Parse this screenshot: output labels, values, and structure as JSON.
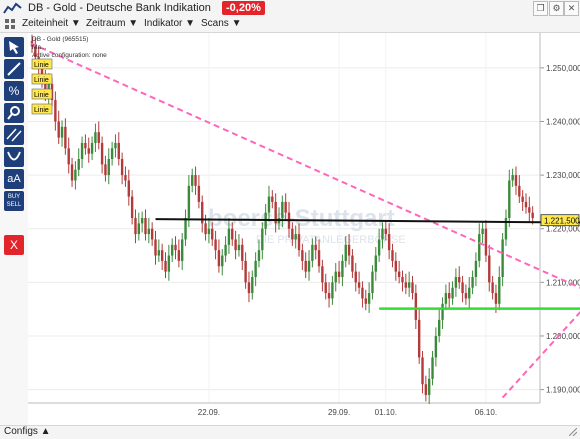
{
  "window": {
    "title": "DB - Gold - Deutsche Bank Indikation",
    "change": "-0,20%"
  },
  "menu": {
    "items": [
      "Zeiteinheit ▼",
      "Zeitraum ▼",
      "Indikator ▼",
      "Scans ▼"
    ]
  },
  "tools": [
    {
      "name": "select-cursor-icon",
      "label": ""
    },
    {
      "name": "line-tool-icon",
      "label": ""
    },
    {
      "name": "percent-tool-icon",
      "label": "%"
    },
    {
      "name": "zoom-icon",
      "label": ""
    },
    {
      "name": "channel-tool-icon",
      "label": ""
    },
    {
      "name": "curve-tool-icon",
      "label": ""
    },
    {
      "name": "text-tool-icon",
      "label": "aA"
    },
    {
      "name": "buy-sell-icon",
      "label": "BUY SELL"
    },
    {
      "name": "delete-icon",
      "label": "X"
    }
  ],
  "status": {
    "configs": "Configs ▲"
  },
  "colors": {
    "up": "#3b8a3b",
    "down": "#b33a3a",
    "trend": "#ff66bb",
    "support": "#33dd33",
    "resistance": "#111111",
    "badge": "#e1252b"
  },
  "chart_data": {
    "type": "candlestick",
    "legend_text": [
      "DB - Gold (965515)",
      "Ma...",
      "Active configuration: none"
    ],
    "line_labels": [
      "Linie",
      "Linie",
      "Linie",
      "Linie"
    ],
    "watermark": [
      "boerse-Stuttgart",
      "DIE PRIVATANLEGERBÖRSE"
    ],
    "ylim": [
      1187.5,
      1256.5
    ],
    "yticks": [
      1190,
      1200,
      1210,
      1220,
      1230,
      1240,
      1250
    ],
    "ytick_labels": [
      "1.190,000",
      "1.200,000",
      "1.210,000",
      "1.220,000",
      "1.230,000",
      "1.240,000",
      "1.250,000"
    ],
    "last_price": 1221.5,
    "last_price_label": "1.221,500",
    "xtick_labels": [
      {
        "label": "22.09.",
        "index": 53
      },
      {
        "label": "29.09.",
        "index": 92
      },
      {
        "label": "01.10.",
        "index": 106
      },
      {
        "label": "06.10.",
        "index": 136
      }
    ],
    "closes": [
      1254,
      1252,
      1250,
      1248,
      1245,
      1247,
      1244,
      1240,
      1237,
      1239,
      1235,
      1232,
      1229,
      1231,
      1233,
      1236,
      1235,
      1234,
      1236,
      1238,
      1236,
      1232,
      1230,
      1233,
      1235,
      1236,
      1233,
      1230,
      1229,
      1226,
      1222,
      1219,
      1221,
      1222,
      1219,
      1220,
      1218,
      1215,
      1216,
      1214,
      1212,
      1215,
      1217,
      1216,
      1214,
      1218,
      1222,
      1228,
      1230,
      1228,
      1225,
      1221,
      1219,
      1220,
      1218,
      1216,
      1213,
      1215,
      1217,
      1220,
      1218,
      1216,
      1217,
      1214,
      1210,
      1208,
      1211,
      1214,
      1216,
      1220,
      1223,
      1226,
      1225,
      1221,
      1222,
      1225,
      1223,
      1220,
      1218,
      1219,
      1216,
      1214,
      1212,
      1214,
      1217,
      1216,
      1213,
      1210,
      1208,
      1207,
      1210,
      1212,
      1211,
      1214,
      1217,
      1215,
      1212,
      1210,
      1209,
      1207,
      1206,
      1208,
      1212,
      1215,
      1218,
      1220,
      1219,
      1216,
      1214,
      1212,
      1211,
      1210,
      1209,
      1210,
      1208,
      1203,
      1196,
      1191,
      1189,
      1192,
      1196,
      1200,
      1203,
      1206,
      1208,
      1207,
      1209,
      1211,
      1210,
      1208,
      1207,
      1209,
      1211,
      1214,
      1219,
      1220,
      1215,
      1210,
      1208,
      1206,
      1211,
      1218,
      1222,
      1229,
      1230,
      1228,
      1226,
      1225,
      1224,
      1223,
      1222
    ],
    "overlays": {
      "resistance": {
        "from": [
          37,
          1221.8
        ],
        "to": [
          175,
          1221.1
        ]
      },
      "support": {
        "from": [
          104,
          1205.1
        ],
        "to": [
          175,
          1205.1
        ]
      },
      "downtrend": {
        "from": [
          -3,
          1255.3
        ],
        "to": [
          166,
          1208.5
        ]
      },
      "uptrend": {
        "from": [
          141,
          1188.5
        ],
        "to": [
          176,
          1212.5
        ]
      }
    }
  }
}
